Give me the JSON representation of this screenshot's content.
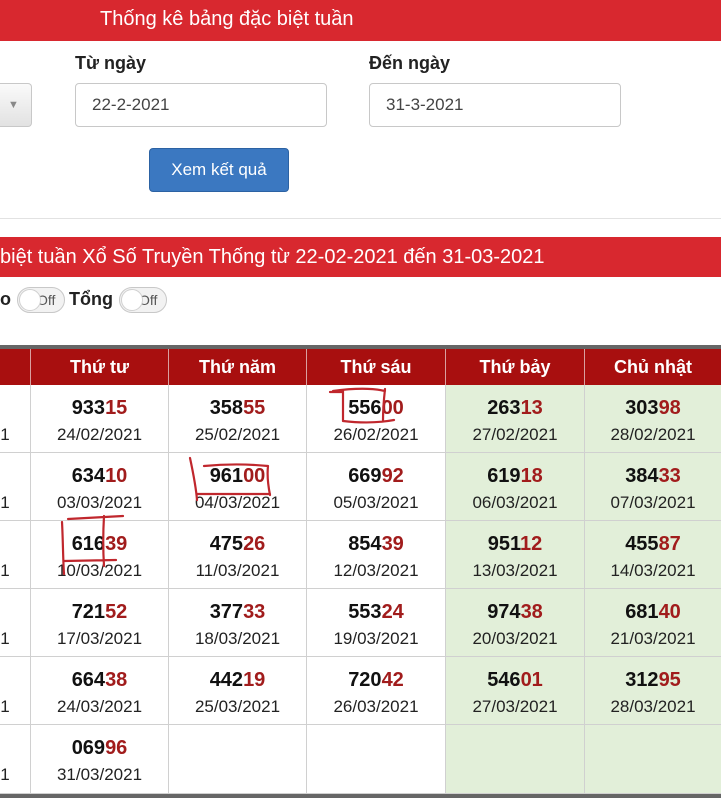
{
  "header": {
    "title": "Thống kê bảng đặc biệt tuần"
  },
  "form": {
    "from_label": "Từ ngày",
    "to_label": "Đến ngày",
    "from_value": "22-2-2021",
    "to_value": "31-3-2021",
    "submit_label": "Xem kết quả"
  },
  "section": {
    "title": "biệt tuần Xổ Số Truyền Thống từ 22-02-2021 đến 31-03-2021"
  },
  "toggles": {
    "first_label_tail": "o",
    "first_state": "Off",
    "second_label": "Tổng",
    "second_state": "Off"
  },
  "table": {
    "columns": [
      "Thứ tư",
      "Thứ năm",
      "Thứ sáu",
      "Thứ bảy",
      "Chủ nhật"
    ],
    "edge_digit": "1",
    "rows": [
      [
        {
          "head": "933",
          "tail": "15",
          "date": "24/02/2021"
        },
        {
          "head": "358",
          "tail": "55",
          "date": "25/02/2021"
        },
        {
          "head": "556",
          "tail": "00",
          "date": "26/02/2021"
        },
        {
          "head": "263",
          "tail": "13",
          "date": "27/02/2021"
        },
        {
          "head": "303",
          "tail": "98",
          "date": "28/02/2021"
        }
      ],
      [
        {
          "head": "634",
          "tail": "10",
          "date": "03/03/2021"
        },
        {
          "head": "961",
          "tail": "00",
          "date": "04/03/2021"
        },
        {
          "head": "669",
          "tail": "92",
          "date": "05/03/2021"
        },
        {
          "head": "619",
          "tail": "18",
          "date": "06/03/2021"
        },
        {
          "head": "384",
          "tail": "33",
          "date": "07/03/2021"
        }
      ],
      [
        {
          "head": "616",
          "tail": "39",
          "date": "10/03/2021"
        },
        {
          "head": "475",
          "tail": "26",
          "date": "11/03/2021"
        },
        {
          "head": "854",
          "tail": "39",
          "date": "12/03/2021"
        },
        {
          "head": "951",
          "tail": "12",
          "date": "13/03/2021"
        },
        {
          "head": "455",
          "tail": "87",
          "date": "14/03/2021"
        }
      ],
      [
        {
          "head": "721",
          "tail": "52",
          "date": "17/03/2021"
        },
        {
          "head": "377",
          "tail": "33",
          "date": "18/03/2021"
        },
        {
          "head": "553",
          "tail": "24",
          "date": "19/03/2021"
        },
        {
          "head": "974",
          "tail": "38",
          "date": "20/03/2021"
        },
        {
          "head": "681",
          "tail": "40",
          "date": "21/03/2021"
        }
      ],
      [
        {
          "head": "664",
          "tail": "38",
          "date": "24/03/2021"
        },
        {
          "head": "442",
          "tail": "19",
          "date": "25/03/2021"
        },
        {
          "head": "720",
          "tail": "42",
          "date": "26/03/2021"
        },
        {
          "head": "546",
          "tail": "01",
          "date": "27/03/2021"
        },
        {
          "head": "312",
          "tail": "95",
          "date": "28/03/2021"
        }
      ],
      [
        {
          "head": "069",
          "tail": "96",
          "date": "31/03/2021"
        },
        null,
        null,
        null,
        null
      ]
    ]
  },
  "colors": {
    "brand_red": "#d8282f",
    "header_dark_red": "#a80f0f",
    "tail_red": "#a11c1c",
    "weekend_green": "#e2efd9",
    "button_blue": "#3b78c1",
    "pen_red": "#c0272d"
  }
}
